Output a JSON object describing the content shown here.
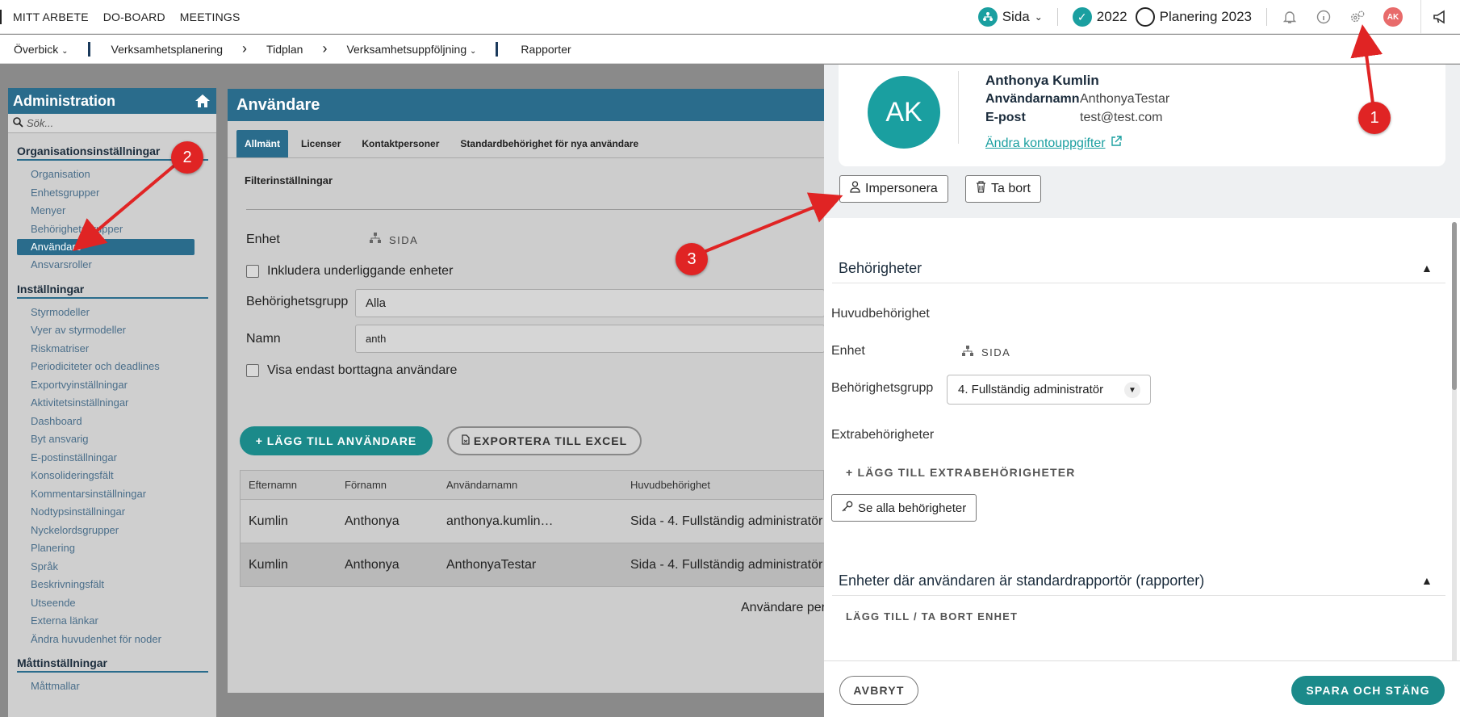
{
  "topnav": {
    "items": [
      "MITT ARBETE",
      "DO-BOARD",
      "MEETINGS"
    ]
  },
  "topright": {
    "org": "Sida",
    "year": "2022",
    "plan": "Planering 2023",
    "avatar": "AK"
  },
  "subnav": {
    "overview": "Överbick",
    "items": [
      "Verksamhetsplanering",
      "Tidplan",
      "Verksamhetsuppföljning",
      "Rapporter"
    ]
  },
  "admin": {
    "title": "Administration",
    "search_placeholder": "Sök...",
    "sections": [
      {
        "title": "Organisationsinställningar",
        "items": [
          "Organisation",
          "Enhetsgrupper",
          "Menyer",
          "Behörighetsgrupper",
          "Användare",
          "Ansvarsroller"
        ]
      },
      {
        "title": "Inställningar",
        "items": [
          "Styrmodeller",
          "Vyer av styrmodeller",
          "Riskmatriser",
          "Periodiciteter och deadlines",
          "Exportvyinställningar",
          "Aktivitetsinställningar",
          "Dashboard",
          "Byt ansvarig",
          "E-postinställningar",
          "Konsolideringsfält",
          "Kommentarsinställningar",
          "Nodtypsinställningar",
          "Nyckelordsgrupper",
          "Planering",
          "Språk",
          "Beskrivningsfält",
          "Utseende",
          "Externa länkar",
          "Ändra huvudenhet för noder"
        ]
      },
      {
        "title": "Måttinställningar",
        "items": [
          "Måttmallar"
        ]
      }
    ],
    "active_item": "Användare"
  },
  "main": {
    "title": "Användare",
    "tabs": [
      "Allmänt",
      "Licenser",
      "Kontaktpersoner",
      "Standardbehörighet för nya användare"
    ],
    "filter_title": "Filterinställningar",
    "enhet_label": "Enhet",
    "enhet_value": "SIDA",
    "include_label": "Inkludera underliggande enheter",
    "group_label": "Behörighetsgrupp",
    "group_value": "Alla",
    "name_label": "Namn",
    "name_value": "anth",
    "deleted_label": "Visa endast borttagna användare",
    "add_button": "+ LÄGG TILL ANVÄNDARE",
    "export_button": "EXPORTERA TILL EXCEL",
    "columns": [
      "Efternamn",
      "Förnamn",
      "Användarnamn",
      "Huvudbehörighet"
    ],
    "rows": [
      [
        "Kumlin",
        "Anthonya",
        "anthonya.kumlin…",
        "Sida - 4. Fullständig administratör"
      ],
      [
        "Kumlin",
        "Anthonya",
        "AnthonyaTestar",
        "Sida - 4. Fullständig administratör"
      ]
    ],
    "pager": "Användare per"
  },
  "drawer": {
    "avatar": "AK",
    "name": "Anthonya Kumlin",
    "username_label": "Användarnamn",
    "username": "AnthonyaTestar",
    "email_label": "E-post",
    "email": "test@test.com",
    "edit_link": "Ändra kontouppgifter",
    "impersonate": "Impersonera",
    "delete": "Ta bort",
    "perm_title": "Behörigheter",
    "main_perm": "Huvudbehörighet",
    "enhet_label": "Enhet",
    "enhet_value": "SIDA",
    "group_label": "Behörighetsgrupp",
    "group_value": "4. Fullständig administratör",
    "extra_perm": "Extrabehörigheter",
    "add_extra": "+ LÄGG TILL EXTRABEHÖRIGHETER",
    "see_all": "Se alla behörigheter",
    "units_title": "Enheter där användaren är standardrapportör (rapporter)",
    "add_remove": "LÄGG TILL / TA BORT ENHET",
    "cancel": "AVBRYT",
    "save": "SPARA OCH STÄNG"
  },
  "annotations": [
    "1",
    "2",
    "3"
  ],
  "colors": {
    "teal": "#1a9fa0",
    "blue": "#2a6c8c",
    "red": "#e02424"
  }
}
